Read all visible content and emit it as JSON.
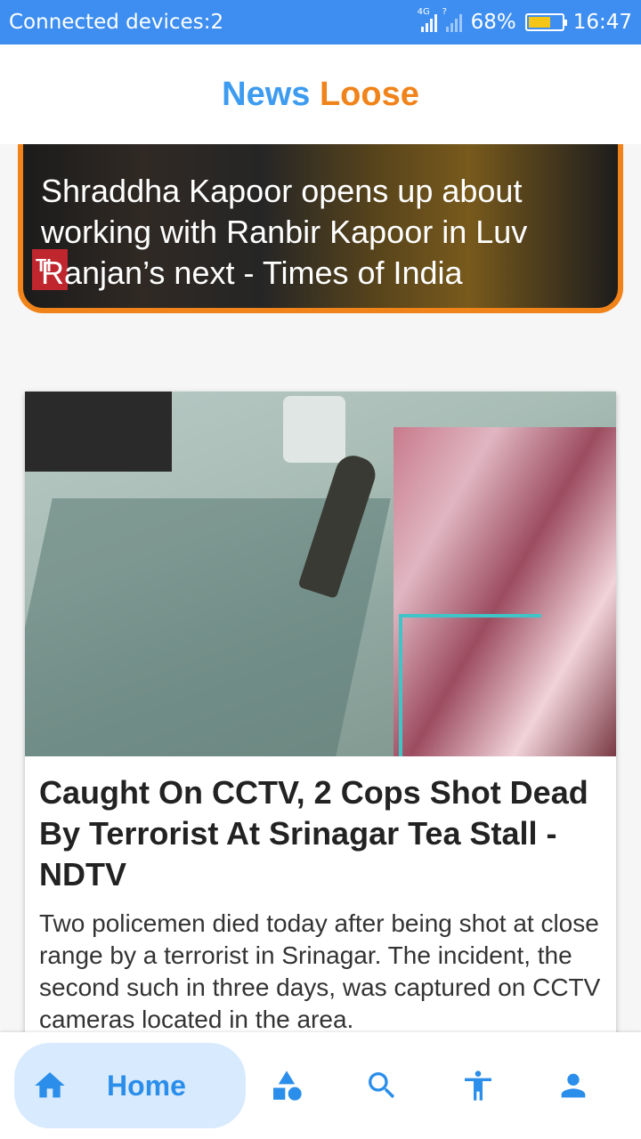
{
  "status_bar": {
    "left_text": "Connected devices:2",
    "network": "4G",
    "unknown_signal": "?",
    "battery": "68%",
    "time": "16:47"
  },
  "app": {
    "title_part1": "News",
    "title_part2": "Loose"
  },
  "featured": {
    "logo_text": "TI",
    "headline": "Shraddha Kapoor opens up about working with Ranbir Kapoor in Luv Ranjan’s next - Times of India"
  },
  "article": {
    "headline": "Caught On CCTV, 2 Cops Shot Dead By Terrorist At Srinagar Tea Stall - NDTV",
    "summary": "Two policemen died today after being shot at close range by a terrorist in Srinagar. The incident, the second such in three days, was captured on CCTV cameras located in the area."
  },
  "bottom_nav": {
    "home_label": "Home",
    "items": [
      "home-icon",
      "categories-icon",
      "search-icon",
      "accessibility-icon",
      "profile-icon"
    ]
  },
  "colors": {
    "accent_blue": "#3d9bf0",
    "accent_orange": "#f08319",
    "status_bar": "#3d8ef0"
  }
}
